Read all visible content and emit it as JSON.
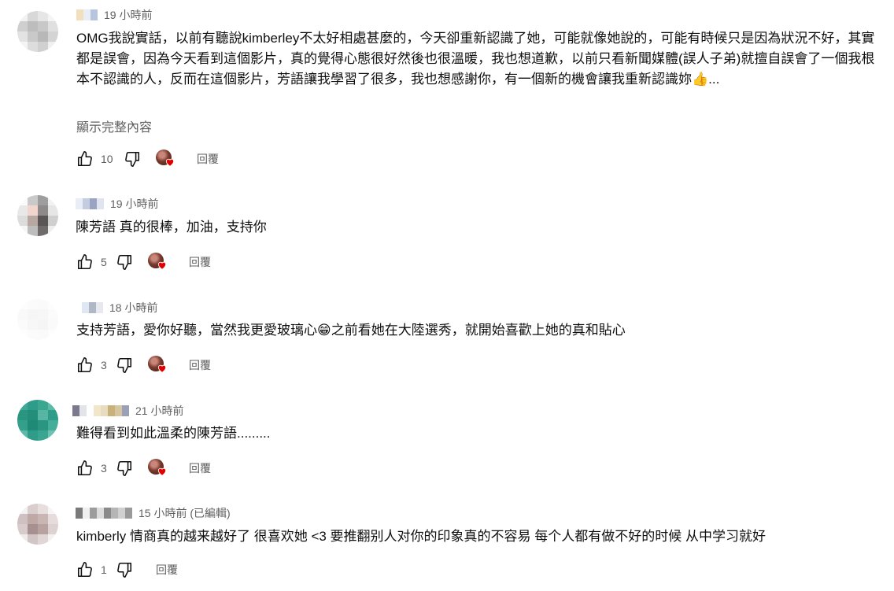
{
  "comments": [
    {
      "time": "19 小時前",
      "text": "OMG我說實話，以前有聽說kimberley不太好相處甚麼的，今天卻重新認識了她，可能就像她說的，可能有時候只是因為狀況不好，其實都是誤會，因為今天看到這個影片，真的覺得心態很好然後也很溫暖，我也想道歉，以前只看新聞媒體(誤人子弟)就擅自誤會了一個我根本不認識的人，反而在這個影片，芳語讓我學習了很多，我也想感謝你，有一個新的機會讓我重新認識妳👍...",
      "show_more": "顯示完整內容",
      "likes": "10",
      "reply": "回覆"
    },
    {
      "time": "19 小時前",
      "text": "陳芳語 真的很棒，加油，支持你",
      "likes": "5",
      "reply": "回覆"
    },
    {
      "time": "18 小時前",
      "text": "支持芳語，愛你好聽，當然我更愛玻璃心😁之前看她在大陸選秀，就開始喜歡上她的真和貼心",
      "likes": "3",
      "reply": "回覆"
    },
    {
      "time": "21 小時前",
      "text": "難得看到如此溫柔的陳芳語.........",
      "likes": "3",
      "reply": "回覆"
    },
    {
      "time": "15 小時前 (已編輯)",
      "text": "kimberly 情商真的越来越好了 很喜欢她 <3 要推翻别人对你的印象真的不容易 每个人都有做不好的时候 从中学习就好",
      "likes": "1",
      "reply": "回覆"
    }
  ],
  "colors": {
    "heart": "#e00000",
    "secondary_text": "#606060",
    "primary_text": "#0f0f0f"
  },
  "icons": [
    "thumbs-up-icon",
    "thumbs-down-icon",
    "creator-heart-icon"
  ]
}
